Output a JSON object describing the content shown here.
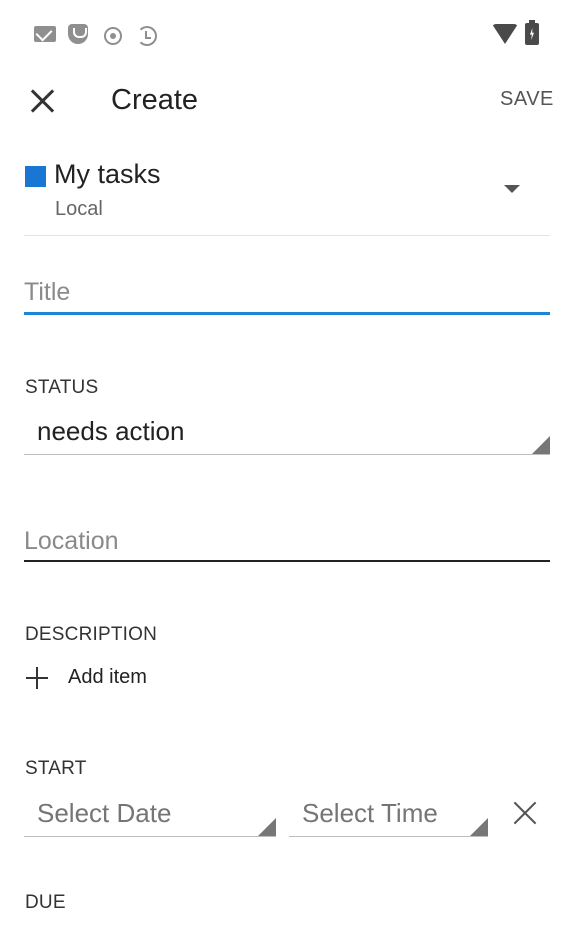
{
  "toolbar": {
    "title": "Create",
    "save_label": "SAVE"
  },
  "list": {
    "name": "My tasks",
    "account": "Local",
    "color": "#1976d2"
  },
  "fields": {
    "title_placeholder": "Title",
    "status_label": "STATUS",
    "status_value": "needs action",
    "location_placeholder": "Location",
    "description_label": "DESCRIPTION",
    "add_item_label": "Add item",
    "start_label": "START",
    "start_date_placeholder": "Select Date",
    "start_time_placeholder": "Select Time",
    "due_label": "DUE"
  },
  "icons": {
    "status_bar": [
      "mail-icon",
      "shield-icon",
      "target-icon",
      "sync-icon",
      "wifi-icon",
      "battery-icon"
    ],
    "close": "close-icon",
    "dropdown": "dropdown-arrow-icon",
    "add": "plus-icon",
    "clear": "clear-icon"
  },
  "colors": {
    "accent": "#1a86d6",
    "text_primary": "#222222",
    "text_secondary": "#666666"
  }
}
